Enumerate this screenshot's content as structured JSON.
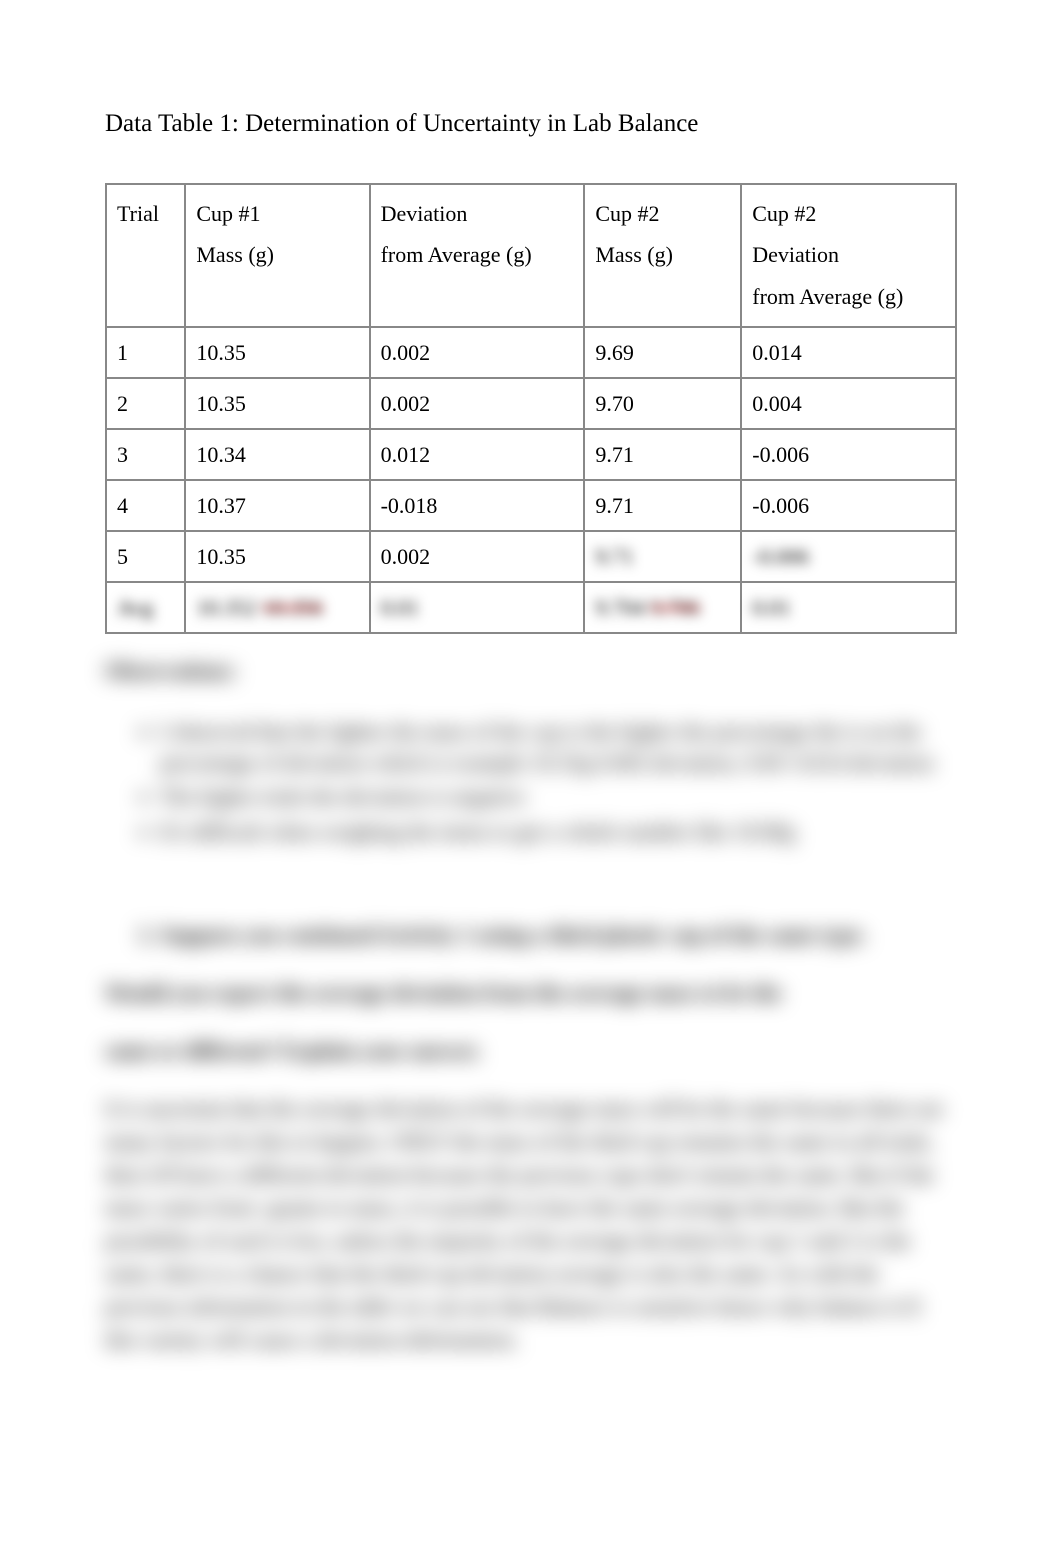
{
  "title": "Data Table 1: Determination of Uncertainty in Lab Balance",
  "table": {
    "headers": [
      "Trial",
      [
        "Cup #1",
        "Mass (g)"
      ],
      [
        "Deviation",
        "from Average (g)"
      ],
      [
        "Cup #2",
        "Mass (g)"
      ],
      [
        "Cup #2",
        "Deviation",
        "from Average (g)"
      ]
    ],
    "rows": [
      {
        "trial": "1",
        "c1mass": "10.35",
        "c1dev": "0.002",
        "c2mass": "9.69",
        "c2dev": "0.014"
      },
      {
        "trial": "2",
        "c1mass": "10.35",
        "c1dev": "0.002",
        "c2mass": "9.70",
        "c2dev": "0.004"
      },
      {
        "trial": "3",
        "c1mass": "10.34",
        "c1dev": "0.012",
        "c2mass": "9.71",
        "c2dev": "-0.006"
      },
      {
        "trial": "4",
        "c1mass": "10.37",
        "c1dev": "-0.018",
        "c2mass": "9.71",
        "c2dev": "-0.006"
      },
      {
        "trial": "5",
        "c1mass": "10.35",
        "c1dev": "0.002",
        "c2mass": "9.71",
        "c2dev": "-0.006"
      }
    ],
    "avg_row": {
      "label": "Avg",
      "c1mass": "10.352",
      "c1mass_strike": "10.356",
      "c1dev": "0.01",
      "c2mass": "9.704",
      "c2mass_strike": "9.706",
      "c2dev": "0.01"
    }
  },
  "obs_heading": "Observations:",
  "obs_items": [
    "I observed that the lighter the mass of the cup is the higher the percentage the is on the percentage of deviation which is example 10.35g 0.002 deviation, 9.69 -0.014 deviation",
    "The higher trials the deviation is negative",
    "It's difficult when weighing the items to get a whole number like 10.00g"
  ],
  "question_num": "1.",
  "question_text": "Suppose you continued Activity 1 using a third plastic cup of the same type.",
  "question_line2": "Would you expect the average deviation from the average mass to be the",
  "question_line3": "same or different? Explain your answer.",
  "answer": "It is uncertain that the average deviation of the average mass will be the same because there are many factors for this to happen. ONLY the mass of the third cup remains the same in all trials, then it'll have a different deviation because the previous cups don't remain the same. But if the mass varies from -grams to mass, it is possible to have the same average deviation. But the possibility of such is low, unless the majority of the average deviation for cup 1 and 2 is the same, there is a chance that the third cup deviation average is also the same. As with the previous information in the table we can see that     Balance is sensitive hence why balance it  ll    this variety will cause a deviation deformation."
}
